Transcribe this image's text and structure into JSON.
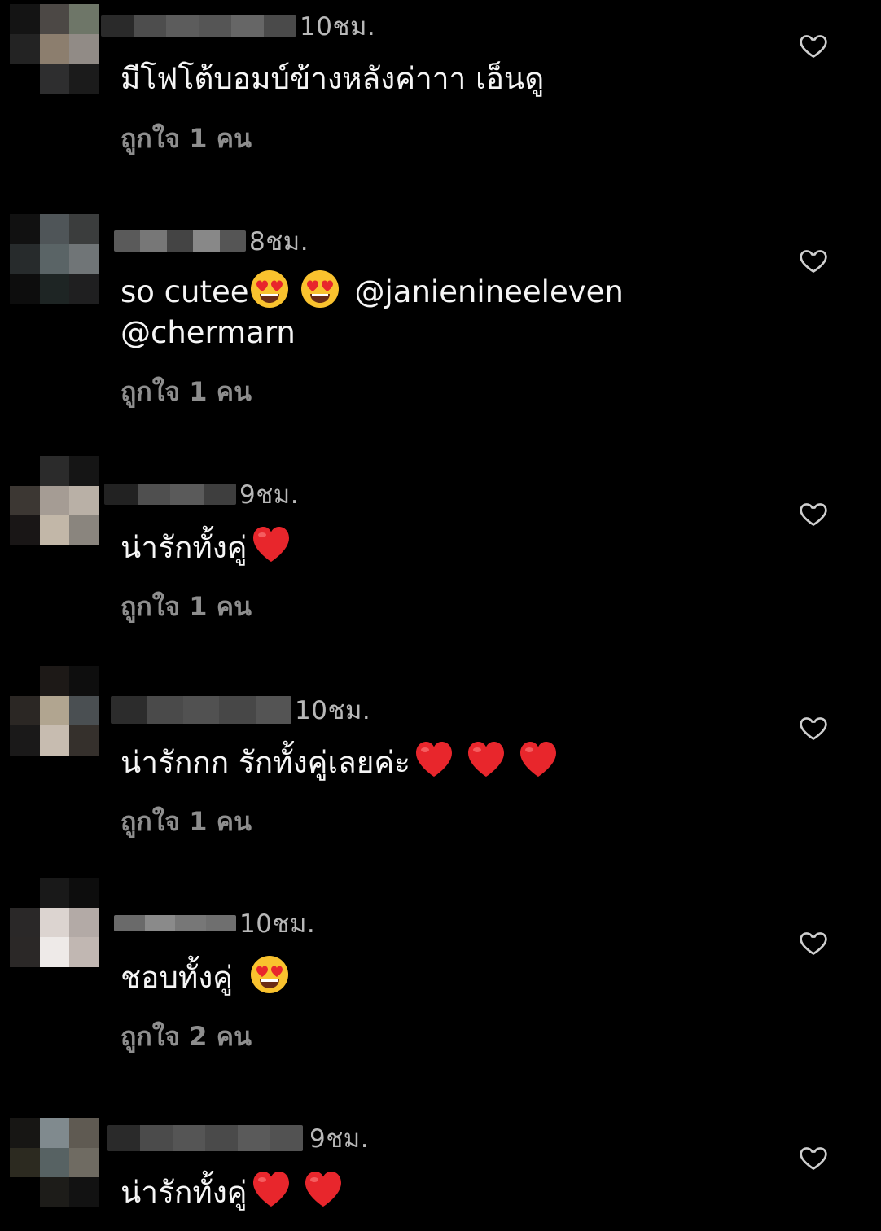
{
  "comments": [
    {
      "time": "10ชม.",
      "text": "มีโฟโต้บอมบ์ข้างหลังค่าาา เอ็นดู",
      "likes": "ถูกใจ 1 คน"
    },
    {
      "time": "8ชม.",
      "text": "so cutee",
      "mention1": "@janienineeleven",
      "mention2": "@chermarn",
      "likes": "ถูกใจ 1 คน"
    },
    {
      "time": "9ชม.",
      "text": "น่ารักทั้งคู่",
      "likes": "ถูกใจ 1 คน"
    },
    {
      "time": "10ชม.",
      "text": "น่ารักกก รักทั้งคู่เลยค่ะ",
      "likes": "ถูกใจ 1 คน"
    },
    {
      "time": "10ชม.",
      "text": "ชอบทั้งคู่",
      "likes": "ถูกใจ 2 คน"
    },
    {
      "time": "9ชม.",
      "text": "น่ารักทั้งคู่"
    }
  ],
  "icons": {
    "like": "heart-outline-icon",
    "heart_emoji": "red-heart-emoji",
    "eyes_emoji": "heart-eyes-emoji"
  },
  "colors": {
    "background": "#000000",
    "text": "#f5f5f5",
    "muted": "#8e8e8e",
    "heart": "#e8262c",
    "emoji_face": "#f9c22e"
  }
}
